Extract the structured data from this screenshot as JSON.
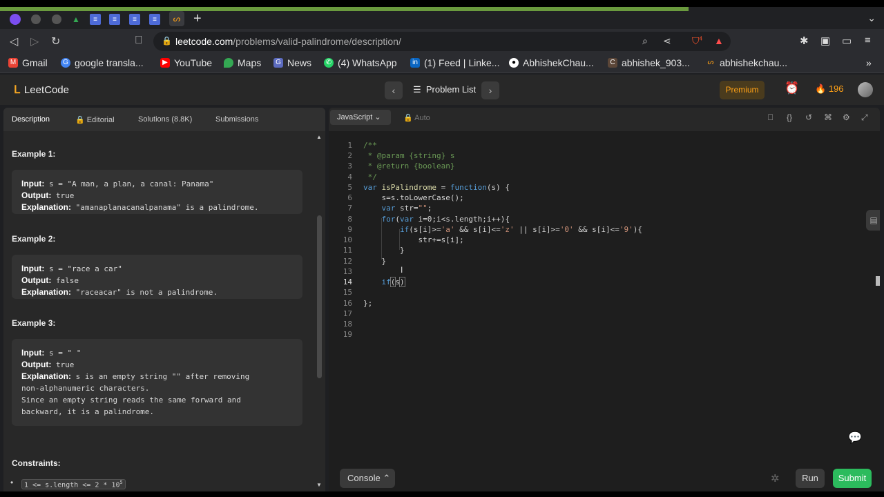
{
  "browser": {
    "url_host": "leetcode.com",
    "url_path": "/problems/valid-palindrome/description/",
    "bookmarks": [
      {
        "label": "Gmail",
        "icon": "gmail-icon",
        "color": "#ea4335"
      },
      {
        "label": "google transla...",
        "icon": "google-icon",
        "color": "#4285f4"
      },
      {
        "label": "YouTube",
        "icon": "youtube-icon",
        "color": "#ff0000"
      },
      {
        "label": "Maps",
        "icon": "maps-icon",
        "color": "#34a853"
      },
      {
        "label": "News",
        "icon": "news-icon",
        "color": "#5c6bc0"
      },
      {
        "label": "(4) WhatsApp",
        "icon": "whatsapp-icon",
        "color": "#25d366"
      },
      {
        "label": "(1) Feed | Linke...",
        "icon": "linkedin-icon",
        "color": "#0a66c2"
      },
      {
        "label": "AbhishekChau...",
        "icon": "github-icon",
        "color": "#333333"
      },
      {
        "label": "abhishek_903...",
        "icon": "codechef-icon",
        "color": "#5b4638"
      },
      {
        "label": "abhishekchau...",
        "icon": "leetcode-icon",
        "color": "#ffa116"
      }
    ],
    "brave_badge": "4"
  },
  "header": {
    "logo": "LeetCode",
    "problem_list": "Problem List",
    "premium": "Premium",
    "streak": "196"
  },
  "left": {
    "tabs": [
      "Description",
      "Editorial",
      "Solutions (8.8K)",
      "Submissions"
    ],
    "examples": [
      {
        "title": "Example 1:",
        "input": "s = \"A man, a plan, a canal: Panama\"",
        "output": "true",
        "explanation": "\"amanaplanacanalpanama\" is a palindrome."
      },
      {
        "title": "Example 2:",
        "input": "s = \"race a car\"",
        "output": "false",
        "explanation": "\"raceacar\" is not a palindrome."
      },
      {
        "title": "Example 3:",
        "input": "s = \" \"",
        "output": "true",
        "explanation": "s is an empty string \"\" after removing",
        "explanation2": "non-alphanumeric characters.",
        "explanation3": "Since an empty string reads the same forward and",
        "explanation4": "backward, it is a palindrome."
      }
    ],
    "labels": {
      "input": "Input:",
      "output": "Output:",
      "explanation": "Explanation:"
    },
    "constraints_title": "Constraints:",
    "constraint1": "1 <= s.length <= 2 * 10",
    "constraint1_sup": "5"
  },
  "editor": {
    "language": "JavaScript",
    "auto": "Auto",
    "console": "Console",
    "run": "Run",
    "submit": "Submit"
  }
}
